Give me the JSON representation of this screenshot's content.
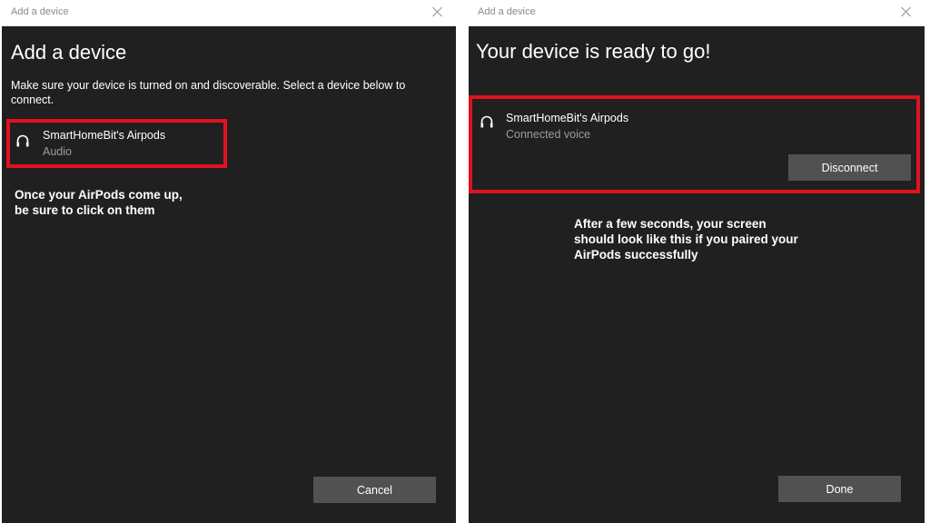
{
  "left_window": {
    "title": "Add a device",
    "heading": "Add a device",
    "instructions": "Make sure your device is turned on and discoverable. Select a device below to connect.",
    "device": {
      "icon": "headphones-icon",
      "name": "SmartHomeBit's Airpods",
      "type": "Audio"
    },
    "annotation": {
      "line1": "Once your AirPods come up,",
      "line2": "be sure to click on them"
    },
    "cancel_label": "Cancel"
  },
  "right_window": {
    "title": "Add a device",
    "heading": "Your device is ready to go!",
    "device": {
      "icon": "headphones-icon",
      "name": "SmartHomeBit's Airpods",
      "status": "Connected voice",
      "disconnect_label": "Disconnect"
    },
    "annotation": {
      "line1": "After a few seconds, your screen",
      "line2": "should look like this if you paired your",
      "line3": "AirPods successfully"
    },
    "done_label": "Done"
  },
  "colors": {
    "dialog_background": "#202020",
    "highlight": "#e0121e",
    "button": "#515151"
  }
}
